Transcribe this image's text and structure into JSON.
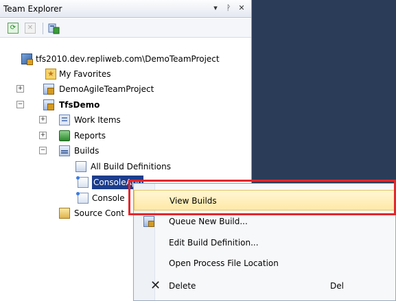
{
  "panel": {
    "title": "Team Explorer",
    "controls": {
      "dropdown": "▾",
      "pin": "ᚹ",
      "close": "✕"
    }
  },
  "toolbar": {
    "refresh_icon": "refresh-icon",
    "stop_icon": "stop-icon",
    "add_project_icon": "add-team-project-icon"
  },
  "tree": {
    "server": "tfs2010.dev.repliweb.com\\DemoTeamProject",
    "favorites": "My Favorites",
    "project1": "DemoAgileTeamProject",
    "project2": "TfsDemo",
    "work_items": "Work Items",
    "reports": "Reports",
    "builds": "Builds",
    "all_build_defs": "All Build Definitions",
    "console_app_1": "ConsoleApp",
    "console_app_2": "Console",
    "source_control": "Source Cont"
  },
  "context_menu": {
    "items": [
      {
        "label": "View Builds",
        "shortcut": "",
        "highlighted": true
      },
      {
        "label": "Queue New Build...",
        "shortcut": ""
      },
      {
        "label": "Edit Build Definition...",
        "shortcut": ""
      },
      {
        "label": "Open Process File Location",
        "shortcut": ""
      },
      {
        "label": "Delete",
        "shortcut": "Del"
      }
    ]
  },
  "colors": {
    "background": "#2b3c59",
    "selection": "#1c3d8c",
    "highlight_border": "#e4262b",
    "hover": "#ffe8a6"
  }
}
